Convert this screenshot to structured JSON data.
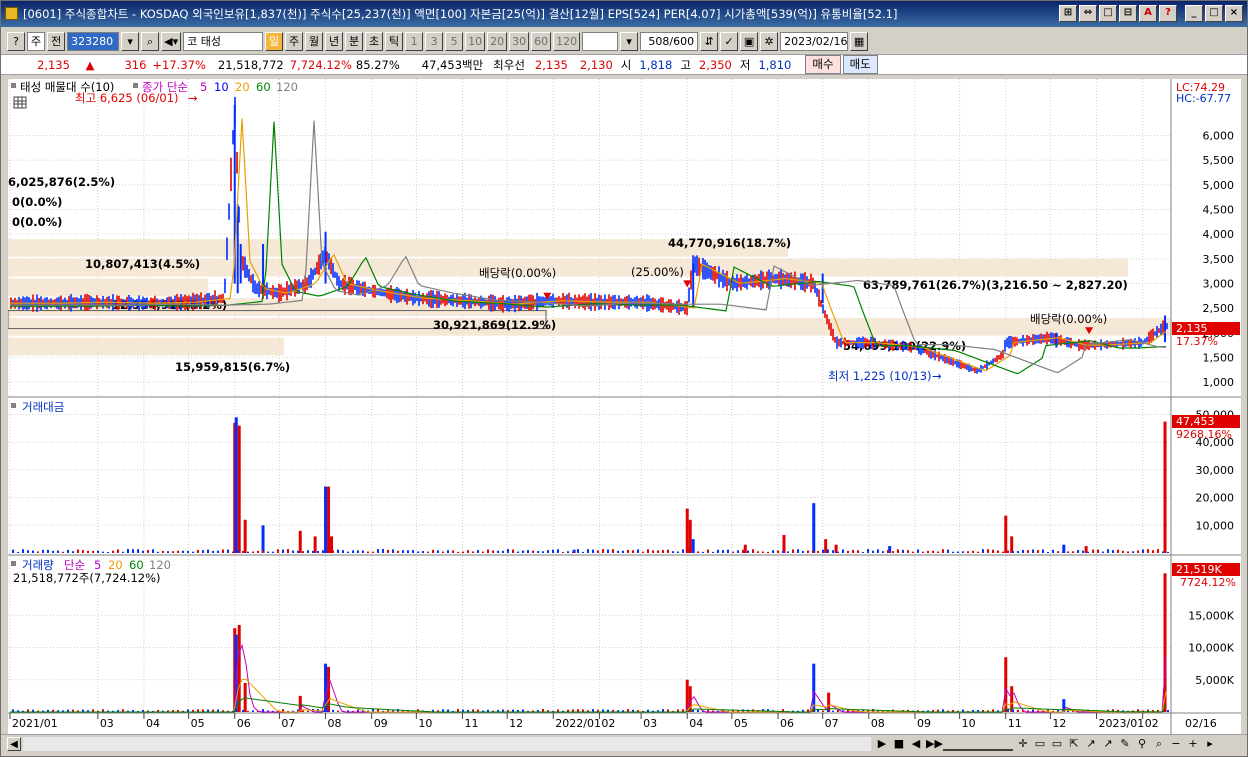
{
  "title": "[0601] 주식종합차트 - KOSDAQ 외국인보유[1,837(천)] 주식수[25,237(천)] 액면[100] 자본금[25(억)] 결산[12월] EPS[524] PER[4.07] 시가총액[539(억)] 유통비율[52.1]",
  "title_buttons": [
    "⊞",
    "⇔",
    "□",
    "⊟",
    "A",
    "?",
    "_",
    "□",
    "×"
  ],
  "toolbar": {
    "market": "주",
    "prev": "전",
    "code": "323280",
    "stock_name": "코 태성",
    "periods": [
      "일",
      "주",
      "월",
      "년",
      "분",
      "초",
      "틱"
    ],
    "active_period": "일",
    "intervals": [
      "1",
      "3",
      "5",
      "10",
      "20",
      "30",
      "60",
      "120"
    ],
    "count": "508",
    "count_total": "/600",
    "date": "2023/02/16"
  },
  "info": {
    "price": "2,135",
    "arrow": "▲",
    "change": "316",
    "change_pct": "+17.37%",
    "volume": "21,518,772",
    "volume_pct": "7,724.12%",
    "ratio": "85.27%",
    "amount": "47,453백만",
    "pref_label": "최우선",
    "ask": "2,135",
    "bid": "2,130",
    "open_label": "시",
    "open": "1,818",
    "high_label": "고",
    "high": "2,350",
    "low_label": "저",
    "low": "1,810",
    "buy": "매수",
    "sell": "매도"
  },
  "price_panel": {
    "legend_name": "태성 매물대 수(10)",
    "legend_ma": "종가 단순",
    "ma_periods": [
      "5",
      "10",
      "20",
      "60",
      "120"
    ],
    "ma_colors": [
      "#c000c0",
      "#0000ff",
      "#e8a000",
      "#008000",
      "#808080"
    ],
    "lc": "LC:74.29",
    "hc": "HC:-67.77",
    "y_ticks": [
      "6,000",
      "5,500",
      "5,000",
      "4,500",
      "4,000",
      "3,500",
      "3,000",
      "2,500",
      "2,000",
      "1,500",
      "1,000"
    ],
    "last_price_tag": "2,135",
    "last_pct_tag": "17.37%",
    "high_note": "최고 6,625 (06/01)",
    "low_note": "최저 1,225 (10/13)",
    "div_note_1": "배당락(0.00%)",
    "div_note_2": "(25.00%)",
    "div_note_3": "배당락(0.00%)",
    "vp_labels": [
      "6,025,876(2.5%)",
      "0(0.0%)",
      "0(0.0%)",
      "44,770,916(18.7%)",
      "10,807,413(4.5%)",
      "63,789,761(26.7%)(3,216.50 ~ 2,827.20)",
      "12,354,917(5.2%)",
      "30,921,869(12.9%)",
      "54,699,100(22.9%)",
      "15,959,815(6.7%)"
    ]
  },
  "amount_panel": {
    "legend": "거래대금",
    "y_ticks": [
      "50,000",
      "40,000",
      "30,000",
      "20,000",
      "10,000"
    ],
    "last_tag": "47,453",
    "last_pct": "9268.16%"
  },
  "volume_panel": {
    "legend": "거래량",
    "legend_ma": "단순",
    "ma_periods": [
      "5",
      "20",
      "60",
      "120"
    ],
    "ma_colors": [
      "#c000c0",
      "#e8a000",
      "#008000",
      "#808080"
    ],
    "sub": "21,518,772주(7,724.12%)",
    "y_ticks": [
      "15,000K",
      "10,000K",
      "5,000K"
    ],
    "last_tag": "21,519K",
    "last_pct": "7724.12%"
  },
  "x_axis": [
    "2021/01",
    "03",
    "04",
    "05",
    "06",
    "07",
    "08",
    "09",
    "10",
    "11",
    "12",
    "2022/01",
    "02",
    "03",
    "04",
    "05",
    "06",
    "07",
    "08",
    "09",
    "10",
    "11",
    "12",
    "2023/01",
    "02"
  ],
  "x_last": "02/16",
  "chart_data": {
    "type": "candlestick",
    "title": "",
    "xlabel": "",
    "ylabel": "",
    "price_ylim": [
      900,
      6700
    ],
    "price_path": [
      [
        "2021-01",
        2600
      ],
      [
        "2021-02",
        2600
      ],
      [
        "2021-03",
        2620
      ],
      [
        "2021-04",
        2600
      ],
      [
        "2021-05",
        2620
      ],
      [
        "2021-05-25",
        2700
      ],
      [
        "2021-06-01",
        6625
      ],
      [
        "2021-06-05",
        3500
      ],
      [
        "2021-06-15",
        2900
      ],
      [
        "2021-07",
        2800
      ],
      [
        "2021-07-20",
        3000
      ],
      [
        "2021-08-01",
        3600
      ],
      [
        "2021-08-10",
        3000
      ],
      [
        "2021-09",
        2850
      ],
      [
        "2021-10",
        2700
      ],
      [
        "2021-11",
        2650
      ],
      [
        "2021-12",
        2580
      ],
      [
        "2022-01",
        2650
      ],
      [
        "2022-02",
        2620
      ],
      [
        "2022-03",
        2620
      ],
      [
        "2022-04-01",
        2500
      ],
      [
        "2022-04-05",
        3400
      ],
      [
        "2022-05",
        3000
      ],
      [
        "2022-06",
        3100
      ],
      [
        "2022-06-25",
        3000
      ],
      [
        "2022-07-01",
        2500
      ],
      [
        "2022-07-10",
        1800
      ],
      [
        "2022-08",
        1800
      ],
      [
        "2022-09",
        1700
      ],
      [
        "2022-10-13",
        1225
      ],
      [
        "2022-10-30",
        1550
      ],
      [
        "2022-11",
        1800
      ],
      [
        "2022-12",
        1900
      ],
      [
        "2022-12-20",
        1750
      ],
      [
        "2023-01",
        1750
      ],
      [
        "2023-02",
        1800
      ],
      [
        "2023-02-16",
        2135
      ]
    ],
    "amount_bars_mil": [
      [
        "2021-06-01",
        47000
      ],
      [
        "2021-06-02",
        49000
      ],
      [
        "2021-06-04",
        46000
      ],
      [
        "2021-06-08",
        12000
      ],
      [
        "2021-06-20",
        10000
      ],
      [
        "2021-07-15",
        8000
      ],
      [
        "2021-07-25",
        6000
      ],
      [
        "2021-08-01",
        24000
      ],
      [
        "2021-08-03",
        24000
      ],
      [
        "2021-08-05",
        6000
      ],
      [
        "2022-01-15",
        1200
      ],
      [
        "2022-04-01",
        16000
      ],
      [
        "2022-04-03",
        12000
      ],
      [
        "2022-04-05",
        5000
      ],
      [
        "2022-05-10",
        3000
      ],
      [
        "2022-06-05",
        6500
      ],
      [
        "2022-06-25",
        18000
      ],
      [
        "2022-07-03",
        5000
      ],
      [
        "2022-07-10",
        3000
      ],
      [
        "2022-08-15",
        2500
      ],
      [
        "2022-11-01",
        13500
      ],
      [
        "2022-11-05",
        6000
      ],
      [
        "2022-12-10",
        3000
      ],
      [
        "2022-12-25",
        2500
      ],
      [
        "2023-02-16",
        47453
      ]
    ],
    "volume_bars_k": [
      [
        "2021-06-01",
        13000
      ],
      [
        "2021-06-02",
        12000
      ],
      [
        "2021-06-04",
        13500
      ],
      [
        "2021-06-08",
        4500
      ],
      [
        "2021-07-15",
        2500
      ],
      [
        "2021-08-01",
        7500
      ],
      [
        "2021-08-03",
        7000
      ],
      [
        "2022-04-01",
        5000
      ],
      [
        "2022-04-03",
        4000
      ],
      [
        "2022-06-25",
        7500
      ],
      [
        "2022-07-05",
        3000
      ],
      [
        "2022-11-01",
        8500
      ],
      [
        "2022-11-05",
        4000
      ],
      [
        "2022-12-10",
        2000
      ],
      [
        "2023-02-16",
        21519
      ]
    ]
  }
}
